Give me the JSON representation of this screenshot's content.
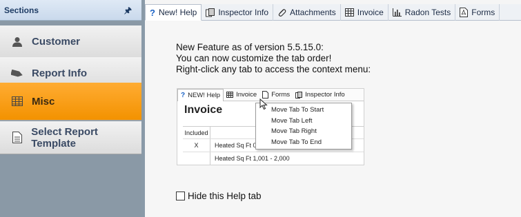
{
  "sidebar": {
    "header": "Sections",
    "items": [
      {
        "label": "Customer",
        "icon": "person-icon",
        "active": false
      },
      {
        "label": "Report Info",
        "icon": "tag-icon",
        "active": false
      },
      {
        "label": "Misc",
        "icon": "grid-icon",
        "active": true
      },
      {
        "label": "Select Report Template",
        "icon": "document-icon",
        "active": false
      }
    ]
  },
  "tabs": [
    {
      "label": "New! Help",
      "icon": "help-icon",
      "active": true
    },
    {
      "label": "Inspector Info",
      "icon": "inspector-icon",
      "active": false
    },
    {
      "label": "Attachments",
      "icon": "paperclip-icon",
      "active": false
    },
    {
      "label": "Invoice",
      "icon": "grid-icon",
      "active": false
    },
    {
      "label": "Radon Tests",
      "icon": "bar-chart-icon",
      "active": false
    },
    {
      "label": "Forms",
      "icon": "pdf-icon",
      "active": false
    }
  ],
  "help": {
    "line1": "New Feature as of version 5.5.15.0:",
    "line2": "You can now customize the tab order!",
    "line3": "Right-click any tab to access the context menu:"
  },
  "demo": {
    "tabs": [
      "NEW! Help",
      "Invoice",
      "Forms",
      "Inspector Info"
    ],
    "title": "Invoice",
    "table_header": "Included",
    "rows": [
      {
        "included": "X",
        "desc": "Heated Sq Ft 0 - 1,000"
      },
      {
        "included": "",
        "desc": "Heated Sq Ft 1,001 - 2,000"
      }
    ],
    "menu": [
      "Move Tab To Start",
      "Move Tab Left",
      "Move Tab Right",
      "Move Tab To End"
    ]
  },
  "hide_label": "Hide this Help tab",
  "colors": {
    "active_section": "#f39200",
    "tab_accent": "#1a62c5"
  }
}
